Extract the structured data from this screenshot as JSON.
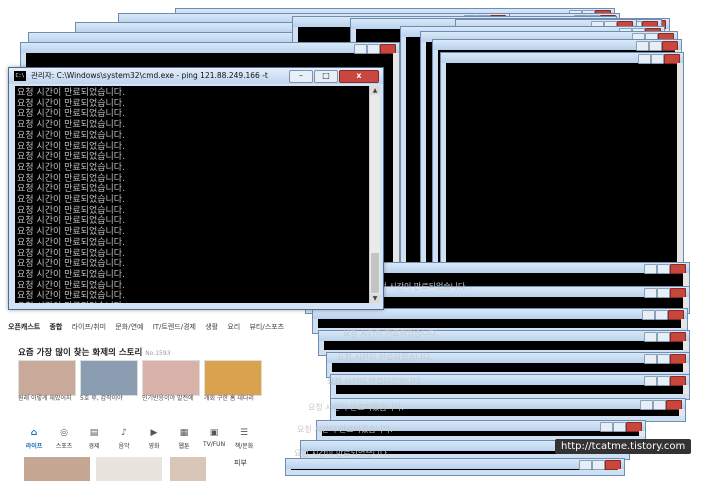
{
  "main_window": {
    "icon": "C:\\",
    "title": "관리자: C:\\Windows\\system32\\cmd.exe - ping  121.88.249.166 -t",
    "buttons": {
      "minimize": "–",
      "maximize": "□",
      "close": "x"
    },
    "lines": [
      "요청 시간이 만료되었습니다.",
      "요청 시간이 만료되었습니다.",
      "요청 시간이 만료되었습니다.",
      "요청 시간이 만료되었습니다.",
      "요청 시간이 만료되었습니다.",
      "요청 시간이 만료되었습니다.",
      "요청 시간이 만료되었습니다.",
      "요청 시간이 만료되었습니다.",
      "요청 시간이 만료되었습니다.",
      "요청 시간이 만료되었습니다.",
      "요청 시간이 만료되었습니다.",
      "요청 시간이 만료되었습니다.",
      "요청 시간이 만료되었습니다.",
      "요청 시간이 만료되었습니다.",
      "요청 시간이 만료되었습니다.",
      "요청 시간이 만료되었습니다.",
      "요청 시간이 만료되었습니다.",
      "요청 시간이 만료되었습니다.",
      "요청 시간이 만료되었습니다.",
      "요청 시간이 만료되었습니다.",
      "요청 시간이 만료되었습니다."
    ]
  },
  "stack_line_text": "요청 시간이 만료되었습니다.",
  "page": {
    "tabs": [
      "오픈캐스트",
      "종합",
      "라이프/취미",
      "문화/연예",
      "IT/트렌드/경제",
      "생활",
      "요리",
      "뷰티/스포츠"
    ],
    "section_title": "요즘 가장 많이 찾는 화제의 스토리",
    "section_count": "No.1593",
    "thumbs": [
      {
        "caption": "원래 이렇게 재밌어지",
        "color": "#c9a99a"
      },
      {
        "caption": "5호 후, 갑작이야",
        "color": "#8b9db0"
      },
      {
        "caption": "인기반응이야 발전에",
        "color": "#d8b2a8"
      },
      {
        "caption": "개회 구한 홈 데다리",
        "color": "#d9a24f"
      }
    ],
    "categories": [
      {
        "icon": "⌂",
        "label": "라이프",
        "active": true
      },
      {
        "icon": "◎",
        "label": "스포츠",
        "active": false
      },
      {
        "icon": "▤",
        "label": "경제",
        "active": false
      },
      {
        "icon": "♪",
        "label": "음악",
        "active": false
      },
      {
        "icon": "▶",
        "label": "영화",
        "active": false
      },
      {
        "icon": "▦",
        "label": "웹툰",
        "active": false
      },
      {
        "icon": "▣",
        "label": "TV/FUN",
        "active": false
      },
      {
        "icon": "☰",
        "label": "책/문화",
        "active": false
      }
    ],
    "bottom_label": "피부"
  },
  "watermark": "http://tcatme.tistory.com"
}
